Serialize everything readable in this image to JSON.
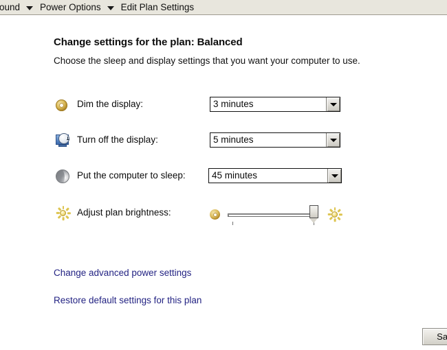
{
  "breadcrumb": {
    "items": [
      {
        "label": "ound",
        "clipped": true
      },
      {
        "label": "Power Options",
        "clipped": false
      },
      {
        "label": "Edit Plan Settings",
        "clipped": false
      }
    ]
  },
  "page": {
    "title": "Change settings for the plan: Balanced",
    "subtitle": "Choose the sleep and display settings that you want your computer to use."
  },
  "settings": {
    "rows": [
      {
        "icon": "dim-display-icon",
        "label": "Dim the display:",
        "control": "combobox",
        "value": "3 minutes"
      },
      {
        "icon": "turn-off-display-icon",
        "label": "Turn off the display:",
        "control": "combobox",
        "value": "5 minutes"
      },
      {
        "icon": "sleep-icon",
        "label": "Put the computer to sleep:",
        "control": "combobox",
        "value": "45 minutes"
      },
      {
        "icon": "brightness-icon",
        "label": "Adjust plan brightness:",
        "control": "slider",
        "value": "92"
      }
    ]
  },
  "links": [
    {
      "label": "Change advanced power settings"
    },
    {
      "label": "Restore default settings for this plan"
    }
  ],
  "footer": {
    "save_label": "Save"
  },
  "colors": {
    "breadcrumb_background": "#e8e6dd",
    "link": "#232383",
    "page_background": "#ffffff",
    "dim_icon": "#d9b855",
    "sun_icon": "#ddc44f",
    "monitor_icon": "#4a79bb"
  }
}
